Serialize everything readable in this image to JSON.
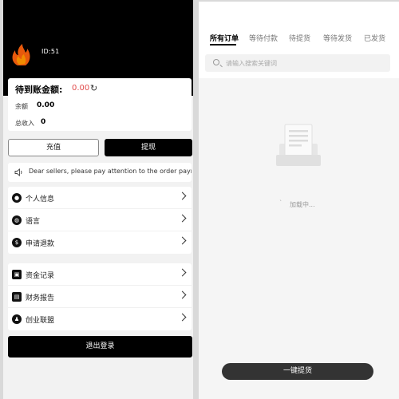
{
  "profile": {
    "uid": "ID:51",
    "logo_name": "flame-logo-icon"
  },
  "balance": {
    "pending_label": "待到账金额:",
    "pending_value": "0.00",
    "balance_label": "余额",
    "balance_value": "0.00",
    "income_label": "总收入",
    "income_value": "0",
    "pending_color": "#e14b4b"
  },
  "actions": {
    "recharge_label": "充值",
    "withdraw_label": "提现"
  },
  "notice": {
    "text": "Dear sellers, please pay attention to the order payr"
  },
  "menu_group_1": [
    {
      "label": "个人信息",
      "icon": "user-icon"
    },
    {
      "label": "语言",
      "icon": "globe-icon"
    },
    {
      "label": "申请退款",
      "icon": "refund-icon"
    }
  ],
  "menu_group_2": [
    {
      "label": "资金记录",
      "icon": "wallet-icon"
    },
    {
      "label": "财务报告",
      "icon": "report-icon"
    },
    {
      "label": "创业联盟",
      "icon": "alliance-icon"
    }
  ],
  "logout_label": "退出登录",
  "orders": {
    "tabs": [
      "所有订单",
      "等待付款",
      "待提货",
      "等待发货",
      "已发货"
    ],
    "active_tab": 0,
    "search_placeholder": "请输入搜索关键词",
    "loading_text": "加载中...",
    "pickup_button": "一键提货"
  }
}
